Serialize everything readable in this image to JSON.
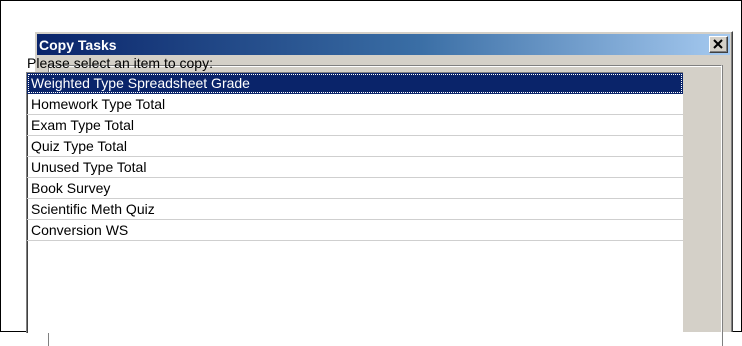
{
  "dialog": {
    "title": "Copy Tasks",
    "close_label": "close",
    "title_gradient_start": "#0a246a",
    "title_gradient_end": "#a6caf0",
    "selection_color": "#0a246a"
  },
  "list": {
    "prompt": "Please select an item to copy:",
    "selected_index": 0,
    "items": [
      {
        "label": "Weighted Type Spreadsheet Grade"
      },
      {
        "label": "Homework Type Total"
      },
      {
        "label": "Exam Type Total"
      },
      {
        "label": "Quiz Type Total"
      },
      {
        "label": "Unused Type Total"
      },
      {
        "label": "Book Survey"
      },
      {
        "label": "Scientific Meth Quiz"
      },
      {
        "label": "Conversion WS"
      }
    ]
  }
}
